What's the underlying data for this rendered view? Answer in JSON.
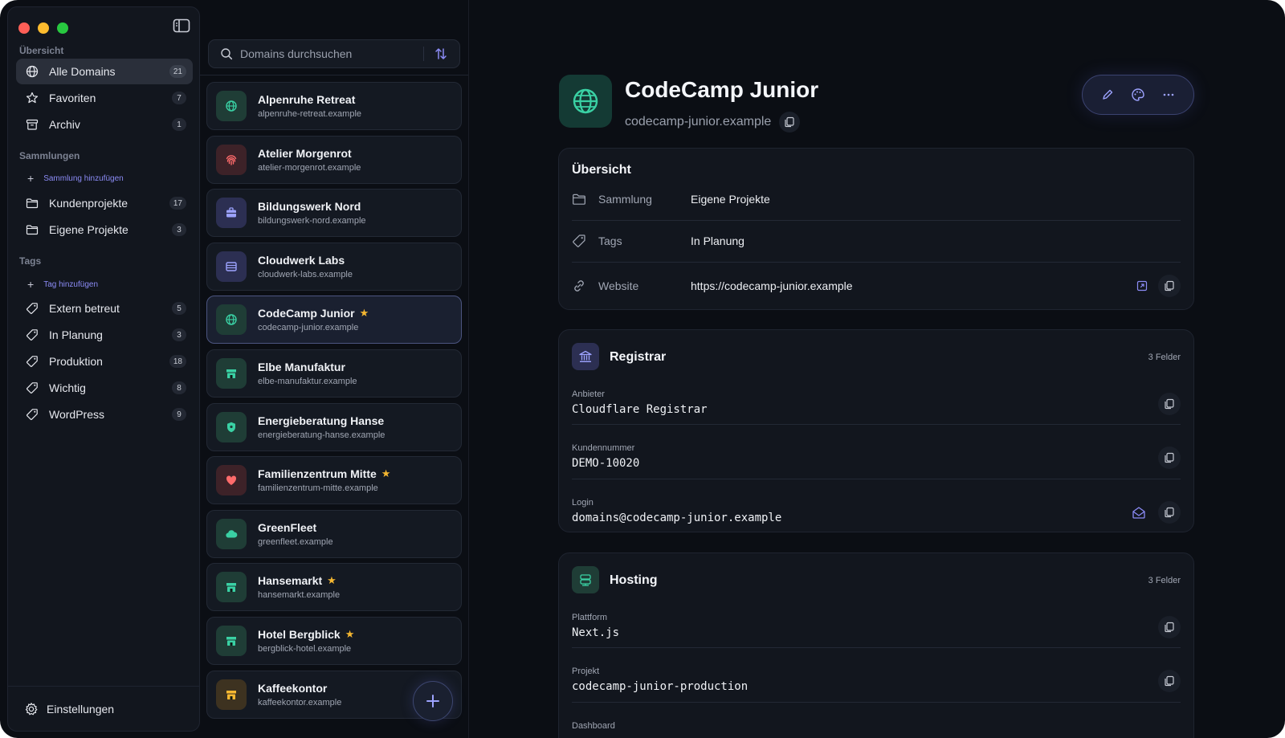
{
  "sidebar": {
    "sections": {
      "overview": "Übersicht",
      "collections": "Sammlungen",
      "tags": "Tags"
    },
    "overview_items": [
      {
        "label": "Alle Domains",
        "count": "21"
      },
      {
        "label": "Favoriten",
        "count": "7"
      },
      {
        "label": "Archiv",
        "count": "1"
      }
    ],
    "add_collection": "Sammlung hinzufügen",
    "collections": [
      {
        "label": "Kundenprojekte",
        "count": "17"
      },
      {
        "label": "Eigene Projekte",
        "count": "3"
      }
    ],
    "add_tag": "Tag hinzufügen",
    "tags": [
      {
        "label": "Extern betreut",
        "count": "5"
      },
      {
        "label": "In Planung",
        "count": "3"
      },
      {
        "label": "Produktion",
        "count": "18"
      },
      {
        "label": "Wichtig",
        "count": "8"
      },
      {
        "label": "WordPress",
        "count": "9"
      }
    ],
    "settings": "Einstellungen"
  },
  "search": {
    "placeholder": "Domains durchsuchen"
  },
  "domains": [
    {
      "name": "Alpenruhe Retreat",
      "domain": "alpenruhe-retreat.example",
      "icon": "globe-icon",
      "color": "#1f3d36",
      "fg": "#3ad1a4"
    },
    {
      "name": "Atelier Morgenrot",
      "domain": "atelier-morgenrot.example",
      "icon": "fingerprint-icon",
      "color": "#3d2228",
      "fg": "#ff6b6b"
    },
    {
      "name": "Bildungswerk Nord",
      "domain": "bildungswerk-nord.example",
      "icon": "briefcase-icon",
      "color": "#2c2f52",
      "fg": "#9da3ff"
    },
    {
      "name": "Cloudwerk Labs",
      "domain": "cloudwerk-labs.example",
      "icon": "server-icon",
      "color": "#2c2f52",
      "fg": "#9da3ff"
    },
    {
      "name": "CodeCamp Junior",
      "domain": "codecamp-junior.example",
      "icon": "globe-icon",
      "color": "#1f3d36",
      "fg": "#3ad1a4",
      "star": "★"
    },
    {
      "name": "Elbe Manufaktur",
      "domain": "elbe-manufaktur.example",
      "icon": "store-icon",
      "color": "#1f3d36",
      "fg": "#3ad1a4"
    },
    {
      "name": "Energieberatung Hanse",
      "domain": "energieberatung-hanse.example",
      "icon": "shield-icon",
      "color": "#1f3d36",
      "fg": "#3ad1a4"
    },
    {
      "name": "Familienzentrum Mitte",
      "domain": "familienzentrum-mitte.example",
      "icon": "heart-icon",
      "color": "#3d2228",
      "fg": "#ff6b6b",
      "star": "★"
    },
    {
      "name": "GreenFleet",
      "domain": "greenfleet.example",
      "icon": "cloud-icon",
      "color": "#1f3d36",
      "fg": "#3ad1a4"
    },
    {
      "name": "Hansemarkt",
      "domain": "hansemarkt.example",
      "icon": "store-icon",
      "color": "#1f3d36",
      "fg": "#3ad1a4",
      "star": "★"
    },
    {
      "name": "Hotel Bergblick",
      "domain": "bergblick-hotel.example",
      "icon": "store-icon",
      "color": "#1f3d36",
      "fg": "#3ad1a4",
      "star": "★"
    },
    {
      "name": "Kaffeekontor",
      "domain": "kaffeekontor.example",
      "icon": "store-icon",
      "color": "#3d3220",
      "fg": "#f5b731"
    }
  ],
  "detail": {
    "title": "CodeCamp Junior",
    "domain": "codecamp-junior.example",
    "overview": {
      "heading": "Übersicht",
      "rows": [
        {
          "key": "Sammlung",
          "value": "Eigene Projekte"
        },
        {
          "key": "Tags",
          "value": "In Planung"
        },
        {
          "key": "Website",
          "value": "https://codecamp-junior.example"
        }
      ]
    },
    "registrar": {
      "heading": "Registrar",
      "count": "3 Felder",
      "fields": [
        {
          "label": "Anbieter",
          "value": "Cloudflare Registrar"
        },
        {
          "label": "Kundennummer",
          "value": "DEMO-10020"
        },
        {
          "label": "Login",
          "value": "domains@codecamp-junior.example"
        }
      ]
    },
    "hosting": {
      "heading": "Hosting",
      "count": "3 Felder",
      "fields": [
        {
          "label": "Plattform",
          "value": "Next.js"
        },
        {
          "label": "Projekt",
          "value": "codecamp-junior-production"
        },
        {
          "label": "Dashboard",
          "value": ""
        }
      ]
    }
  },
  "colors": {
    "accent": "#8b8bf5",
    "teal": "#3ad1a4",
    "star": "#f5b731",
    "background": "#0b0e14"
  }
}
